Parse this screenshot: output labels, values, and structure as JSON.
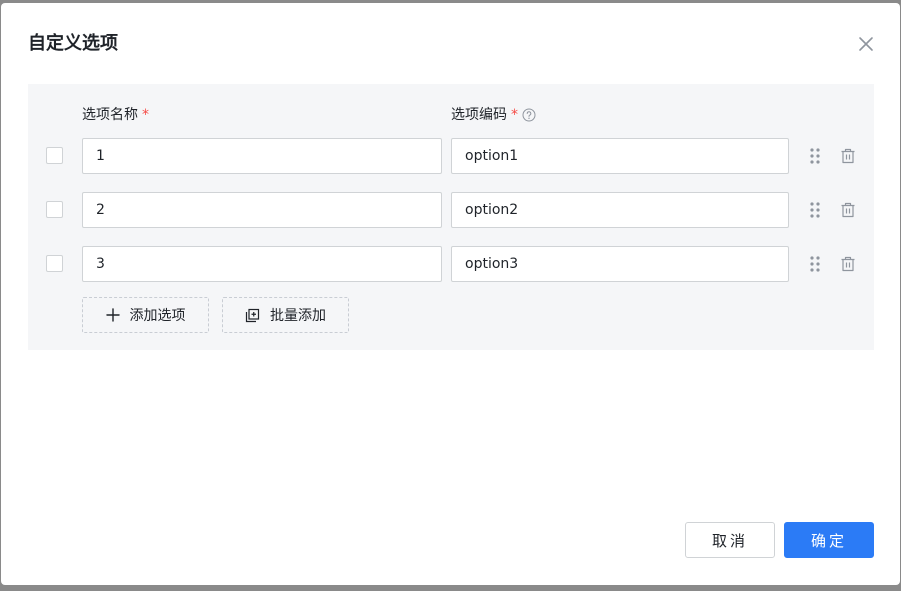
{
  "dialog": {
    "title": "自定义选项"
  },
  "columns": {
    "name_label": "选项名称",
    "code_label": "选项编码",
    "required_mark": "*"
  },
  "options": [
    {
      "name": "1",
      "code": "option1"
    },
    {
      "name": "2",
      "code": "option2"
    },
    {
      "name": "3",
      "code": "option3"
    }
  ],
  "actions": {
    "add_option": "添加选项",
    "batch_add": "批量添加"
  },
  "footer": {
    "cancel": "取消",
    "confirm": "确定"
  },
  "colors": {
    "primary": "#2b7bf6",
    "required": "#f54a45",
    "panel_bg": "#f5f6f8"
  }
}
